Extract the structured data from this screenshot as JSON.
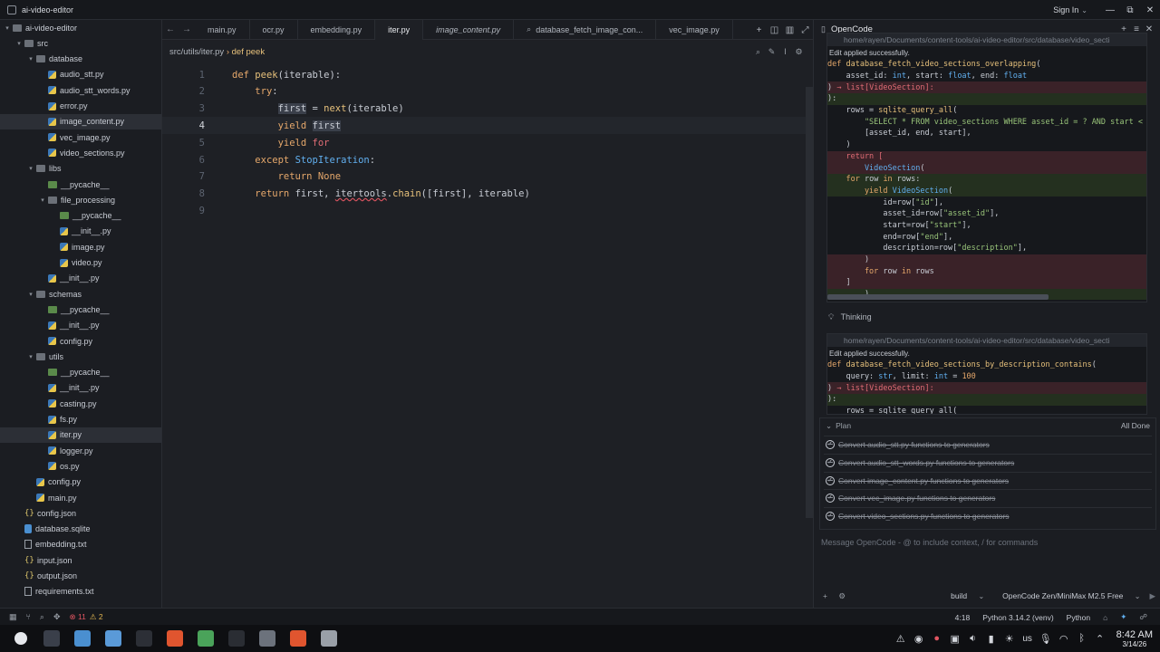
{
  "window": {
    "title": "ai-video-editor",
    "signin_label": "Sign In",
    "controls": [
      "⌄",
      "—",
      "⧉",
      "✕"
    ]
  },
  "sidebar": {
    "items": [
      {
        "label": "ai-video-editor",
        "kind": "folder",
        "indent": 0,
        "open": true
      },
      {
        "label": "src",
        "kind": "folder",
        "indent": 1,
        "open": true
      },
      {
        "label": "database",
        "kind": "folder",
        "indent": 2,
        "open": true,
        "active": true
      },
      {
        "label": "audio_stt.py",
        "kind": "py",
        "indent": 3
      },
      {
        "label": "audio_stt_words.py",
        "kind": "py",
        "indent": 3
      },
      {
        "label": "error.py",
        "kind": "py",
        "indent": 3
      },
      {
        "label": "image_content.py",
        "kind": "py",
        "indent": 3,
        "active": true
      },
      {
        "label": "vec_image.py",
        "kind": "py",
        "indent": 3
      },
      {
        "label": "video_sections.py",
        "kind": "py",
        "indent": 3
      },
      {
        "label": "libs",
        "kind": "folder",
        "indent": 2,
        "open": true
      },
      {
        "label": "__pycache__",
        "kind": "pycache",
        "indent": 3
      },
      {
        "label": "file_processing",
        "kind": "folder",
        "indent": 3,
        "open": true
      },
      {
        "label": "__pycache__",
        "kind": "pycache",
        "indent": 4
      },
      {
        "label": "__init__.py",
        "kind": "py",
        "indent": 4
      },
      {
        "label": "image.py",
        "kind": "py",
        "indent": 4
      },
      {
        "label": "video.py",
        "kind": "py",
        "indent": 4
      },
      {
        "label": "__init__.py",
        "kind": "py",
        "indent": 3
      },
      {
        "label": "schemas",
        "kind": "folder",
        "indent": 2,
        "open": true
      },
      {
        "label": "__pycache__",
        "kind": "pycache",
        "indent": 3
      },
      {
        "label": "__init__.py",
        "kind": "py",
        "indent": 3
      },
      {
        "label": "config.py",
        "kind": "py",
        "indent": 3
      },
      {
        "label": "utils",
        "kind": "folder",
        "indent": 2,
        "open": true
      },
      {
        "label": "__pycache__",
        "kind": "pycache",
        "indent": 3
      },
      {
        "label": "__init__.py",
        "kind": "py",
        "indent": 3
      },
      {
        "label": "casting.py",
        "kind": "py",
        "indent": 3
      },
      {
        "label": "fs.py",
        "kind": "py",
        "indent": 3
      },
      {
        "label": "iter.py",
        "kind": "py",
        "indent": 3,
        "active": true
      },
      {
        "label": "logger.py",
        "kind": "py",
        "indent": 3
      },
      {
        "label": "os.py",
        "kind": "py",
        "indent": 3
      },
      {
        "label": "config.py",
        "kind": "py",
        "indent": 2
      },
      {
        "label": "main.py",
        "kind": "py",
        "indent": 2
      },
      {
        "label": "config.json",
        "kind": "json",
        "indent": 1
      },
      {
        "label": "database.sqlite",
        "kind": "db",
        "indent": 1
      },
      {
        "label": "embedding.txt",
        "kind": "txt",
        "indent": 1
      },
      {
        "label": "input.json",
        "kind": "json",
        "indent": 1
      },
      {
        "label": "output.json",
        "kind": "json",
        "indent": 1
      },
      {
        "label": "requirements.txt",
        "kind": "txt",
        "indent": 1
      }
    ]
  },
  "editor": {
    "tabs": [
      {
        "label": "main.py",
        "active": false,
        "italic": false
      },
      {
        "label": "ocr.py",
        "active": false,
        "italic": false
      },
      {
        "label": "embedding.py",
        "active": false,
        "italic": false
      },
      {
        "label": "iter.py",
        "active": true,
        "italic": false
      },
      {
        "label": "image_content.py",
        "active": false,
        "italic": true
      },
      {
        "label": "database_fetch_image_con...",
        "active": false,
        "italic": false,
        "search": true
      },
      {
        "label": "vec_image.py",
        "active": false,
        "italic": false
      }
    ],
    "breadcrumb_path": "src/utils/iter.py",
    "breadcrumb_sep": "›",
    "breadcrumb_symbol": "def peek",
    "current_line": 4,
    "lines": [
      {
        "n": "1",
        "tokens": [
          [
            "kw",
            "def "
          ],
          [
            "fn",
            "peek"
          ],
          [
            "var",
            "(iterable):"
          ]
        ]
      },
      {
        "n": "2",
        "tokens": [
          [
            "var",
            "    "
          ],
          [
            "kw",
            "try"
          ],
          [
            "var",
            ":"
          ]
        ]
      },
      {
        "n": "3",
        "tokens": [
          [
            "var",
            "        "
          ],
          [
            "hl",
            "first"
          ],
          [
            "var",
            " = "
          ],
          [
            "fn",
            "next"
          ],
          [
            "var",
            "(iterable)"
          ]
        ]
      },
      {
        "n": "4",
        "tokens": [
          [
            "var",
            "        "
          ],
          [
            "kw",
            "yield "
          ],
          [
            "hl",
            "first"
          ]
        ]
      },
      {
        "n": "5",
        "tokens": [
          [
            "var",
            "        "
          ],
          [
            "kw",
            "yield "
          ],
          [
            "kwred",
            "for"
          ]
        ]
      },
      {
        "n": "6",
        "tokens": [
          [
            "var",
            "    "
          ],
          [
            "kw",
            "except "
          ],
          [
            "cls",
            "StopIteration"
          ],
          [
            "var",
            ":"
          ]
        ]
      },
      {
        "n": "7",
        "tokens": [
          [
            "var",
            "        "
          ],
          [
            "kw",
            "return "
          ],
          [
            "kw",
            "None"
          ]
        ]
      },
      {
        "n": "8",
        "tokens": [
          [
            "var",
            "    "
          ],
          [
            "kw",
            "return "
          ],
          [
            "var",
            "first, "
          ],
          [
            "und",
            "itertools"
          ],
          [
            "var",
            "."
          ],
          [
            "fn",
            "chain"
          ],
          [
            "var",
            "([first], iterable)"
          ]
        ]
      },
      {
        "n": "9",
        "tokens": []
      }
    ]
  },
  "statusbar": {
    "errors": "11",
    "warnings": "2",
    "cursor": "4:18",
    "interpreter": "Python 3.14.2 (venv)",
    "language": "Python"
  },
  "panel": {
    "title": "OpenCode",
    "diff1": {
      "path": "home/rayen/Documents/content-tools/ai-video-editor/src/database/video_secti",
      "status": "Edit applied successfully.",
      "lines": [
        {
          "t": "",
          "tokens": [
            [
              "dk",
              "def "
            ],
            [
              "df",
              "database_fetch_video_sections_overlapping"
            ],
            [
              "",
              "("
            ]
          ]
        },
        {
          "t": "",
          "tokens": [
            [
              "",
              "    asset_id: "
            ],
            [
              "dc",
              "int"
            ],
            [
              "",
              ", start: "
            ],
            [
              "dc",
              "float"
            ],
            [
              "",
              ", end: "
            ],
            [
              "dc",
              "float"
            ]
          ]
        },
        {
          "t": "del",
          "tokens": [
            [
              "",
              ") "
            ],
            [
              "dred",
              "→ list[VideoSection]:"
            ]
          ]
        },
        {
          "t": "add",
          "tokens": [
            [
              "",
              "):"
            ]
          ]
        },
        {
          "t": "",
          "tokens": [
            [
              "",
              "    rows = "
            ],
            [
              "df",
              "sqlite_query_all"
            ],
            [
              "",
              "("
            ]
          ]
        },
        {
          "t": "",
          "tokens": [
            [
              "ds",
              "        \"SELECT * FROM video_sections WHERE asset_id = ? AND start < ? AND"
            ]
          ]
        },
        {
          "t": "",
          "tokens": [
            [
              "",
              "        [asset_id, end, start],"
            ]
          ]
        },
        {
          "t": "",
          "tokens": [
            [
              "",
              "    )"
            ]
          ]
        },
        {
          "t": "del",
          "tokens": [
            [
              "dred",
              "    return ["
            ]
          ]
        },
        {
          "t": "del",
          "tokens": [
            [
              "dc",
              "        VideoSection"
            ],
            [
              "",
              "("
            ]
          ]
        },
        {
          "t": "add",
          "tokens": [
            [
              "dk",
              "    for "
            ],
            [
              "",
              "row "
            ],
            [
              "dk",
              "in "
            ],
            [
              "",
              "rows:"
            ]
          ]
        },
        {
          "t": "add",
          "tokens": [
            [
              "dk",
              "        yield "
            ],
            [
              "dc",
              "VideoSection"
            ],
            [
              "",
              "("
            ]
          ]
        },
        {
          "t": "",
          "tokens": [
            [
              "",
              "            id=row["
            ],
            [
              "ds",
              "\"id\""
            ],
            [
              "",
              "],"
            ]
          ]
        },
        {
          "t": "",
          "tokens": [
            [
              "",
              "            asset_id=row["
            ],
            [
              "ds",
              "\"asset_id\""
            ],
            [
              "",
              "],"
            ]
          ]
        },
        {
          "t": "",
          "tokens": [
            [
              "",
              "            start=row["
            ],
            [
              "ds",
              "\"start\""
            ],
            [
              "",
              "],"
            ]
          ]
        },
        {
          "t": "",
          "tokens": [
            [
              "",
              "            end=row["
            ],
            [
              "ds",
              "\"end\""
            ],
            [
              "",
              "],"
            ]
          ]
        },
        {
          "t": "",
          "tokens": [
            [
              "",
              "            description=row["
            ],
            [
              "ds",
              "\"description\""
            ],
            [
              "",
              "],"
            ]
          ]
        },
        {
          "t": "del",
          "tokens": [
            [
              "",
              "        )"
            ]
          ]
        },
        {
          "t": "del",
          "tokens": [
            [
              "dk",
              "        for "
            ],
            [
              "",
              "row "
            ],
            [
              "dk",
              "in "
            ],
            [
              "",
              "rows"
            ]
          ]
        },
        {
          "t": "del",
          "tokens": [
            [
              "",
              "    ]"
            ]
          ]
        },
        {
          "t": "add",
          "tokens": [
            [
              "",
              "        )"
            ]
          ]
        }
      ]
    },
    "thinking_label": "Thinking",
    "diff2": {
      "path": "home/rayen/Documents/content-tools/ai-video-editor/src/database/video_secti",
      "status": "Edit applied successfully.",
      "lines": [
        {
          "t": "",
          "tokens": [
            [
              "dk",
              "def "
            ],
            [
              "df",
              "database_fetch_video_sections_by_description_contains"
            ],
            [
              "",
              "("
            ]
          ]
        },
        {
          "t": "",
          "tokens": [
            [
              "",
              "    query: "
            ],
            [
              "dc",
              "str"
            ],
            [
              "",
              ", limit: "
            ],
            [
              "dc",
              "int"
            ],
            [
              "",
              " = "
            ],
            [
              "dk",
              "100"
            ]
          ]
        },
        {
          "t": "del",
          "tokens": [
            [
              "",
              ") "
            ],
            [
              "dred",
              "→ list[VideoSection]:"
            ]
          ]
        },
        {
          "t": "add",
          "tokens": [
            [
              "",
              "):"
            ]
          ]
        },
        {
          "t": "",
          "tokens": [
            [
              "",
              "    rows = sqlite_query_all("
            ]
          ]
        }
      ]
    },
    "plan": {
      "label": "Plan",
      "status": "All Done",
      "items": [
        "Convert audio_stt.py functions to generators",
        "Convert audio_stt_words.py functions to generators",
        "Convert image_content.py functions to generators",
        "Convert vec_image.py functions to generators",
        "Convert video_sections.py functions to generators"
      ]
    },
    "input_placeholder": "Message OpenCode - @ to include context, / for commands",
    "footer": {
      "mode": "build",
      "model": "OpenCode Zen/MiniMax M2.5 Free"
    }
  },
  "taskbar": {
    "keyboard_layout": "us",
    "time": "8:42 AM",
    "date": "3/14/26",
    "apps": [
      {
        "name": "launcher",
        "color": "#e6e8ec"
      },
      {
        "name": "terminal-app",
        "color": "#3a3f4a"
      },
      {
        "name": "files-app",
        "color": "#4a8fd0"
      },
      {
        "name": "file-manager-app",
        "color": "#5a9ad8"
      },
      {
        "name": "zed-editor-app",
        "color": "#2c2f36"
      },
      {
        "name": "brave-browser-app",
        "color": "#e0552f"
      },
      {
        "name": "monitor-app",
        "color": "#4aa35a"
      },
      {
        "name": "console-app",
        "color": "#2a2d33"
      },
      {
        "name": "obs-app",
        "color": "#6c727c"
      },
      {
        "name": "brave-browser-app-2",
        "color": "#e0552f"
      },
      {
        "name": "database-app",
        "color": "#9aa0a8"
      }
    ]
  }
}
